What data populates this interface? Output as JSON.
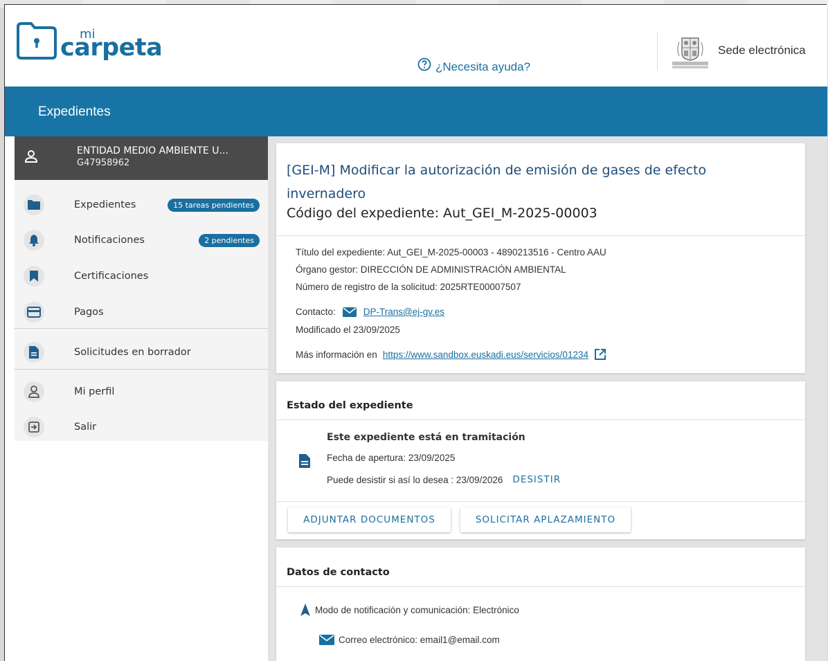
{
  "header": {
    "logo_mi": "mi",
    "logo_carpeta": "carpeta",
    "help_text": "¿Necesita ayuda?",
    "sede_text": "Sede electrónica"
  },
  "bluebar": {
    "title": "Expedientes"
  },
  "user": {
    "name": "ENTIDAD MEDIO AMBIENTE U...",
    "id": "G47958962"
  },
  "sidebar": {
    "items": [
      {
        "label": "Expedientes",
        "badge": "15 tareas pendientes",
        "icon": "folder-icon"
      },
      {
        "label": "Notificaciones",
        "badge": "2 pendientes",
        "icon": "bell-icon"
      },
      {
        "label": "Certificaciones",
        "icon": "bookmark-icon"
      },
      {
        "label": "Pagos",
        "icon": "credit-card-icon"
      },
      {
        "label": "Solicitudes en borrador",
        "icon": "document-icon"
      },
      {
        "label": "Mi perfil",
        "icon": "user-icon"
      },
      {
        "label": "Salir",
        "icon": "logout-icon"
      }
    ]
  },
  "procedure": {
    "title": "[GEI-M] Modificar la autorización de emisión de gases de efecto invernadero",
    "code": "Código del expediente: Aut_GEI_M-2025-00003",
    "titulo": "Título del expediente: Aut_GEI_M-2025-00003 - 4890213516 - Centro AAU",
    "organo": "Órgano gestor: DIRECCIÓN DE ADMINISTRACIÓN AMBIENTAL",
    "registro": "Número de registro de la solicitud: 2025RTE00007507",
    "contacto_label": "Contacto:",
    "contacto_email": "DP-Trans@ej-gv.es",
    "modificado": "Modificado el 23/09/2025",
    "mas_info_label": "Más información en",
    "mas_info_url": "https://www.sandbox.euskadi.eus/servicios/01234"
  },
  "estado": {
    "section_title": "Estado del expediente",
    "status": "Este expediente está en tramitación",
    "apertura": "Fecha de apertura: 23/09/2025",
    "desistir_text": "Puede desistir si así lo desea : 23/09/2026",
    "desistir_label": "DESISTIR",
    "btn_adjuntar": "ADJUNTAR DOCUMENTOS",
    "btn_aplazamiento": "SOLICITAR APLAZAMIENTO"
  },
  "contacto": {
    "section_title": "Datos de contacto",
    "modo": "Modo de notificación y comunicación: Electrónico",
    "correo": "Correo electrónico: email1@email.com"
  },
  "colors": {
    "brand_blue": "#1874a6",
    "link_blue": "#1a6fa0",
    "title_blue": "#1f4e79"
  }
}
